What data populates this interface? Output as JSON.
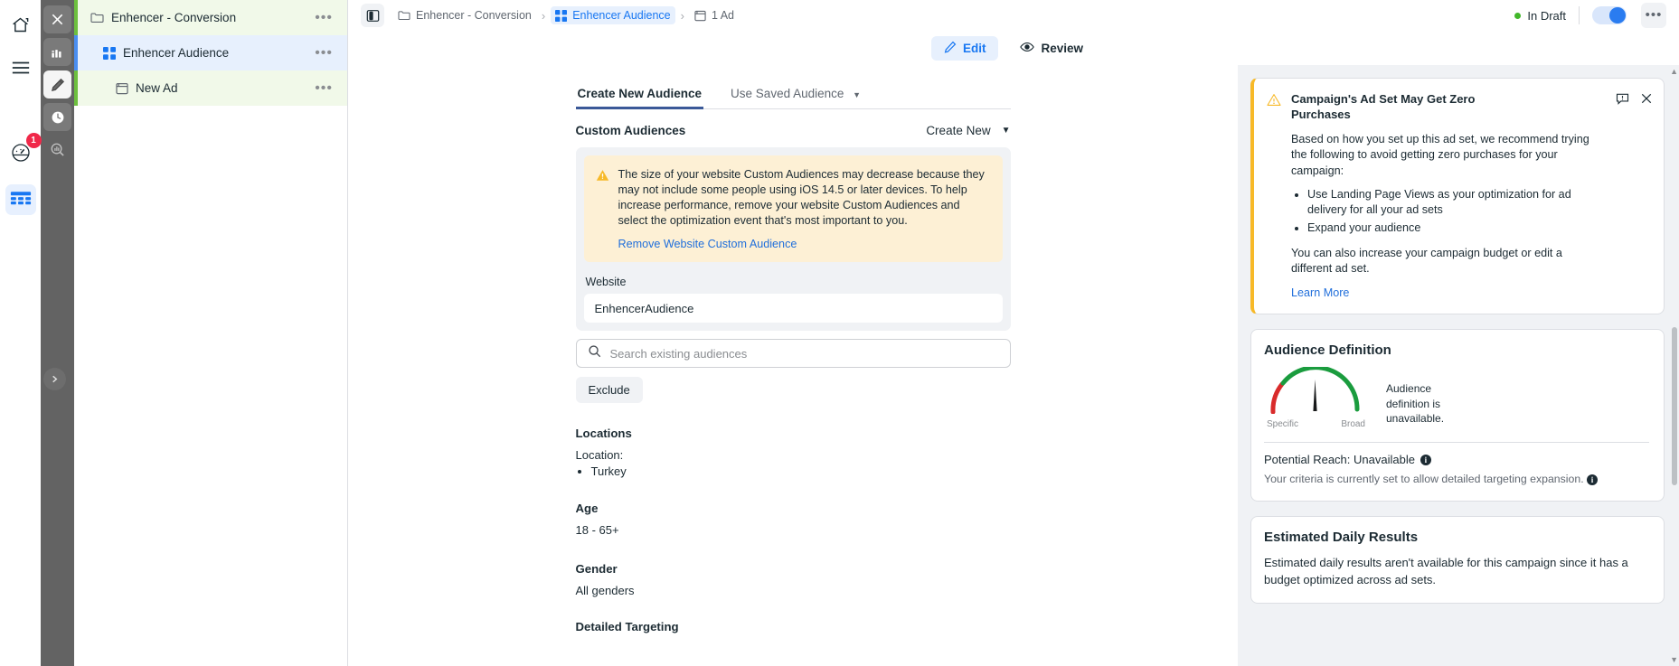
{
  "left_rail": {
    "items": [
      {
        "name": "home-icon",
        "label": "Home"
      },
      {
        "name": "menu-icon",
        "label": "Menu"
      },
      {
        "name": "speedometer-icon",
        "label": "Performance",
        "badge": "1"
      },
      {
        "name": "table-icon",
        "label": "Table",
        "active": true
      }
    ]
  },
  "dark_toolbar": {
    "items": [
      {
        "name": "close-icon",
        "label": "Close"
      },
      {
        "name": "bar-chart-icon",
        "label": "Charts"
      },
      {
        "name": "pencil-icon",
        "label": "Edit",
        "active": true
      },
      {
        "name": "clock-icon",
        "label": "History"
      },
      {
        "name": "search-chart-icon",
        "label": "Inspect"
      }
    ],
    "expand_label": "Expand"
  },
  "tree": {
    "rows": [
      {
        "label": "Enhencer - Conversion",
        "icon": "folder-icon",
        "level": 1,
        "kind": "campaign",
        "menu": "•••"
      },
      {
        "label": "Enhencer Audience",
        "icon": "grid-icon",
        "level": 2,
        "kind": "adset",
        "menu": "•••"
      },
      {
        "label": "New Ad",
        "icon": "ad-icon",
        "level": 3,
        "kind": "ad",
        "menu": "•••"
      }
    ]
  },
  "topbar": {
    "panel_toggle": "panel-toggle-icon",
    "breadcrumbs": [
      {
        "label": "Enhencer - Conversion",
        "icon": "folder-icon",
        "active": false
      },
      {
        "label": "Enhencer Audience",
        "icon": "grid-icon",
        "active": true
      },
      {
        "label": "1 Ad",
        "icon": "ad-icon",
        "active": false
      }
    ],
    "separator": "›",
    "status": "In Draft",
    "status_color": "#42b72a",
    "toggle_on": true,
    "more_label": "•••"
  },
  "mode_tabs": [
    {
      "label": "Edit",
      "icon": "pencil-icon",
      "active": true
    },
    {
      "label": "Review",
      "icon": "eye-icon",
      "active": false
    }
  ],
  "audience": {
    "tabs": [
      {
        "label": "Create New Audience",
        "active": true,
        "caret": false
      },
      {
        "label": "Use Saved Audience",
        "active": false,
        "caret": true
      }
    ],
    "section_title": "Custom Audiences",
    "create_new": "Create New",
    "warning": {
      "text": "The size of your website Custom Audiences may decrease because they may not include some people using iOS 14.5 or later devices. To help increase performance, remove your website Custom Audiences and select the optimization event that's most important to you.",
      "link": "Remove Website Custom Audience"
    },
    "website_label": "Website",
    "website_value": "EnhencerAudience",
    "search_placeholder": "Search existing audiences",
    "exclude_label": "Exclude",
    "locations": {
      "title": "Locations",
      "line": "Location:",
      "items": [
        "Turkey"
      ]
    },
    "age": {
      "title": "Age",
      "value": "18 - 65+"
    },
    "gender": {
      "title": "Gender",
      "value": "All genders"
    },
    "next_section": "Detailed Targeting"
  },
  "right_rail": {
    "alert": {
      "title": "Campaign's Ad Set May Get Zero Purchases",
      "paragraph": "Based on how you set up this ad set, we recommend trying the following to avoid getting zero purchases for your campaign:",
      "bullets": [
        "Use Landing Page Views as your optimization for ad delivery for all your ad sets",
        "Expand your audience"
      ],
      "footer": "You can also increase your campaign budget or edit a different ad set.",
      "link": "Learn More",
      "feedback_icon": "feedback-icon",
      "close_icon": "close-icon"
    },
    "definition": {
      "title": "Audience Definition",
      "gauge_left": "Specific",
      "gauge_right": "Broad",
      "note": "Audience definition is unavailable.",
      "reach": "Potential Reach: Unavailable",
      "reach_sub": "Your criteria is currently set to allow detailed targeting expansion.",
      "info_icon": "info-icon"
    },
    "estimates": {
      "title": "Estimated Daily Results",
      "body": "Estimated daily results aren't available for this campaign since it has a budget optimized across ad sets."
    }
  },
  "colors": {
    "accent_blue": "#1877f2",
    "warn_yellow": "#f7b928",
    "status_green": "#42b72a",
    "campaign_green": "#6dbf3e"
  }
}
